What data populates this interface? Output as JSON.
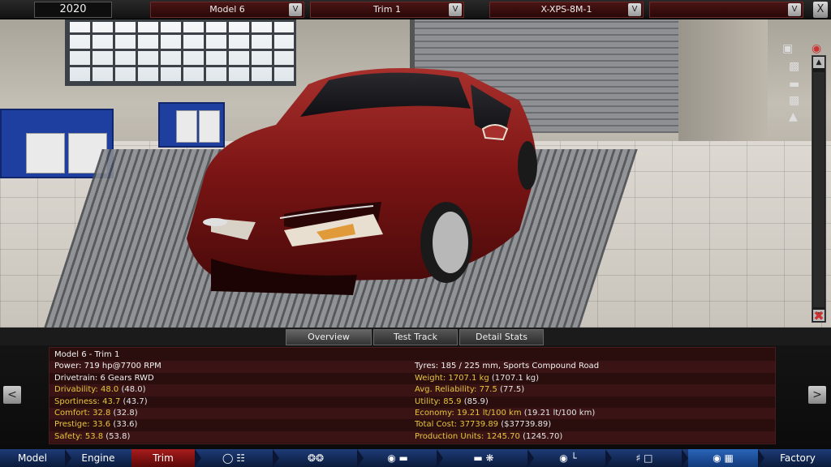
{
  "topbar": {
    "year": "2020",
    "model": "Model 6",
    "trim": "Trim 1",
    "engine": "X-XPS-8M-1",
    "fourth": "",
    "dropdown_glyph": "V",
    "close_glyph": "X"
  },
  "tabs": [
    {
      "label": "Overview",
      "active": true
    },
    {
      "label": "Test Track",
      "active": false
    },
    {
      "label": "Detail Stats",
      "active": false
    }
  ],
  "stats": {
    "title": "Model 6 - Trim 1",
    "left": [
      {
        "label": "Power:",
        "value": "719 hp@7700 RPM",
        "paren": "",
        "color": "white"
      },
      {
        "label": "Drivetrain:",
        "value": "6 Gears RWD",
        "paren": "",
        "color": "white"
      },
      {
        "label": "Drivability:",
        "value": "48.0",
        "paren": "(48.0)",
        "color": "yellow"
      },
      {
        "label": "Sportiness:",
        "value": "43.7",
        "paren": "(43.7)",
        "color": "yellow"
      },
      {
        "label": "Comfort:",
        "value": "32.8",
        "paren": "(32.8)",
        "color": "yellow"
      },
      {
        "label": "Prestige:",
        "value": "33.6",
        "paren": "(33.6)",
        "color": "yellow"
      },
      {
        "label": "Safety:",
        "value": "53.8",
        "paren": "(53.8)",
        "color": "yellow"
      }
    ],
    "right": [
      {
        "label": "Tyres:",
        "value": "185 / 225 mm, Sports Compound Road",
        "paren": "",
        "color": "white"
      },
      {
        "label": "Weight:",
        "value": "1707.1 kg",
        "paren": "(1707.1 kg)",
        "color": "yellow"
      },
      {
        "label": "Avg. Reliability:",
        "value": "77.5",
        "paren": "(77.5)",
        "color": "yellow"
      },
      {
        "label": "Utility:",
        "value": "85.9",
        "paren": "(85.9)",
        "color": "yellow"
      },
      {
        "label": "Economy:",
        "value": "19.21 lt/100 km",
        "paren": "(19.21 lt/100 km)",
        "color": "yellow"
      },
      {
        "label": "Total Cost:",
        "value": "37739.89",
        "paren": "($37739.89)",
        "color": "yellow"
      },
      {
        "label": "Production Units:",
        "value": "1245.70",
        "paren": "(1245.70)",
        "color": "yellow"
      }
    ],
    "prev_glyph": "<",
    "next_glyph": ">"
  },
  "bottom_nav": {
    "items": [
      {
        "label": "Model",
        "active": false
      },
      {
        "label": "Engine",
        "active": false
      },
      {
        "label": "Trim",
        "active": true
      },
      {
        "label": "Factory",
        "active": false
      }
    ],
    "icons": [
      "chassis-gears-icon",
      "wheels-icon",
      "body-icon",
      "car-fan-icon",
      "interior-seat-icon",
      "suspension-icon",
      "finish-flag-icon"
    ]
  },
  "colors": {
    "car": "#7a1414",
    "stat_yellow": "#e8c53a",
    "panel_bg": "#2a0e0e",
    "nav_active": "#a81c1c",
    "nav_bg": "#1e3c78"
  }
}
